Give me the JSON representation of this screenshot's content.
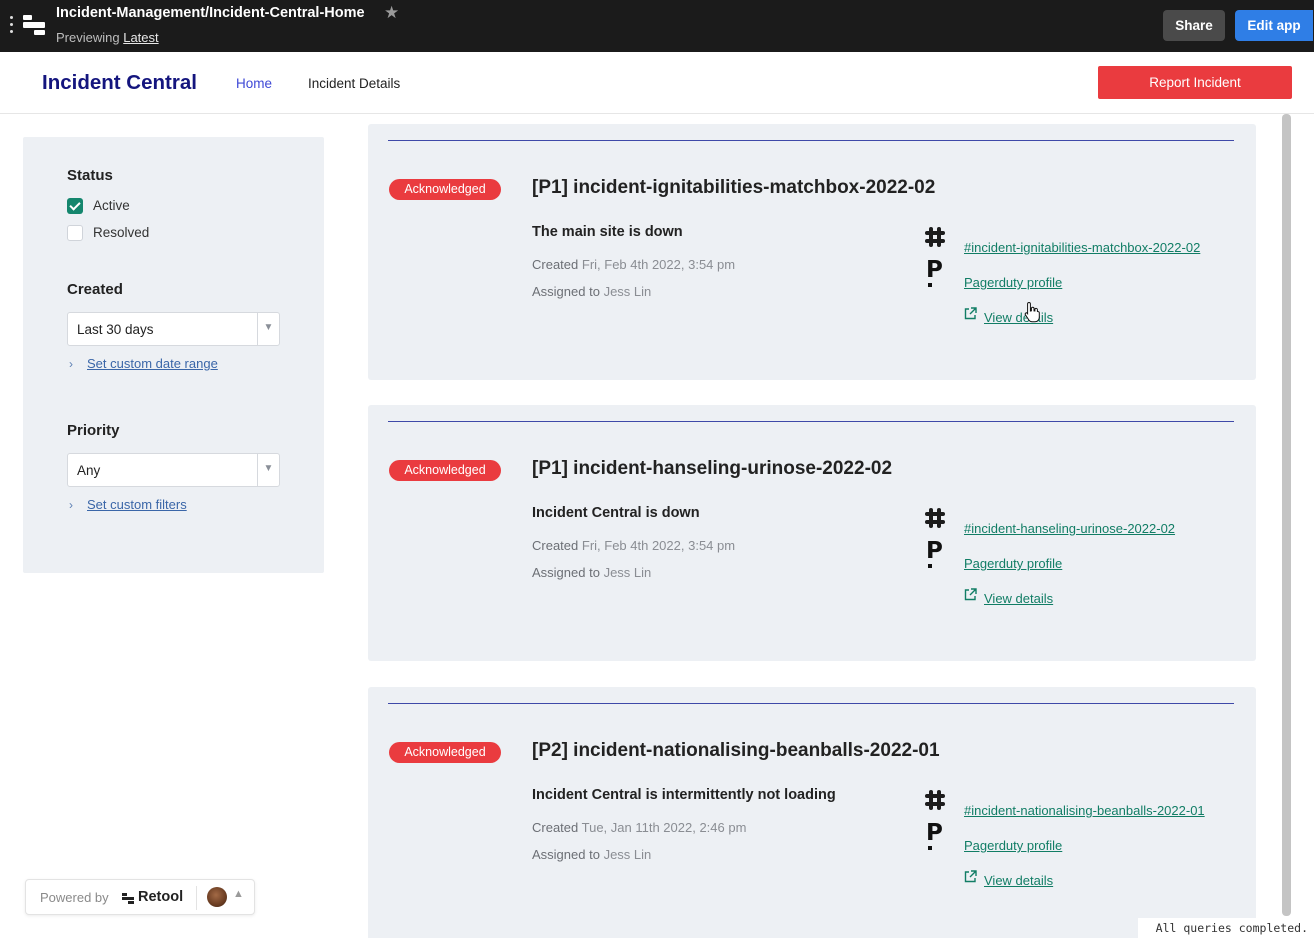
{
  "topbar": {
    "app_path": "Incident-Management/Incident-Central-Home",
    "previewing_label": "Previewing",
    "version_link": "Latest",
    "share_label": "Share",
    "edit_label": "Edit app"
  },
  "header": {
    "title": "Incident Central",
    "nav": [
      {
        "label": "Home",
        "active": true
      },
      {
        "label": "Incident Details",
        "active": false
      }
    ],
    "report_label": "Report Incident"
  },
  "filters": {
    "status_heading": "Status",
    "status_options": [
      {
        "label": "Active",
        "checked": true
      },
      {
        "label": "Resolved",
        "checked": false
      }
    ],
    "created_heading": "Created",
    "created_value": "Last 30 days",
    "created_link": "Set custom date range",
    "priority_heading": "Priority",
    "priority_value": "Any",
    "priority_link": "Set custom filters"
  },
  "meta_labels": {
    "created": "Created",
    "assigned": "Assigned to"
  },
  "incidents": [
    {
      "status": "Acknowledged",
      "title": "[P1] incident-ignitabilities-matchbox-2022-02",
      "summary": "The main site is down",
      "created": "Fri, Feb 4th 2022, 3:54 pm",
      "assignee": "Jess Lin",
      "slack_channel": "#incident-ignitabilities-matchbox-2022-02",
      "pagerduty_label": "Pagerduty profile",
      "details_label": "View details"
    },
    {
      "status": "Acknowledged",
      "title": "[P1] incident-hanseling-urinose-2022-02",
      "summary": "Incident Central is down",
      "created": "Fri, Feb 4th 2022, 3:54 pm",
      "assignee": "Jess Lin",
      "slack_channel": "#incident-hanseling-urinose-2022-02",
      "pagerduty_label": "Pagerduty profile",
      "details_label": "View details"
    },
    {
      "status": "Acknowledged",
      "title": "[P2] incident-nationalising-beanballs-2022-01",
      "summary": "Incident Central is intermittently not loading",
      "created": "Tue, Jan 11th 2022, 2:46 pm",
      "assignee": "Jess Lin",
      "slack_channel": "#incident-nationalising-beanballs-2022-01",
      "pagerduty_label": "Pagerduty profile",
      "details_label": "View details"
    }
  ],
  "footer": {
    "powered_by": "Powered by",
    "brand": "Retool",
    "status_text": "All queries completed."
  },
  "colors": {
    "brand_title": "#14157e",
    "nav_active": "#3f49d6",
    "danger": "#ea3b3f",
    "link_green": "#117d65",
    "panel_bg": "#edf0f4",
    "edit_button": "#2f7ee6"
  },
  "icons": [
    "menu-dots-icon",
    "retool-logo-icon",
    "star-icon",
    "chevron-down-icon",
    "chevron-right-icon",
    "slack-icon",
    "pagerduty-icon",
    "external-link-icon",
    "chevron-up-icon"
  ]
}
